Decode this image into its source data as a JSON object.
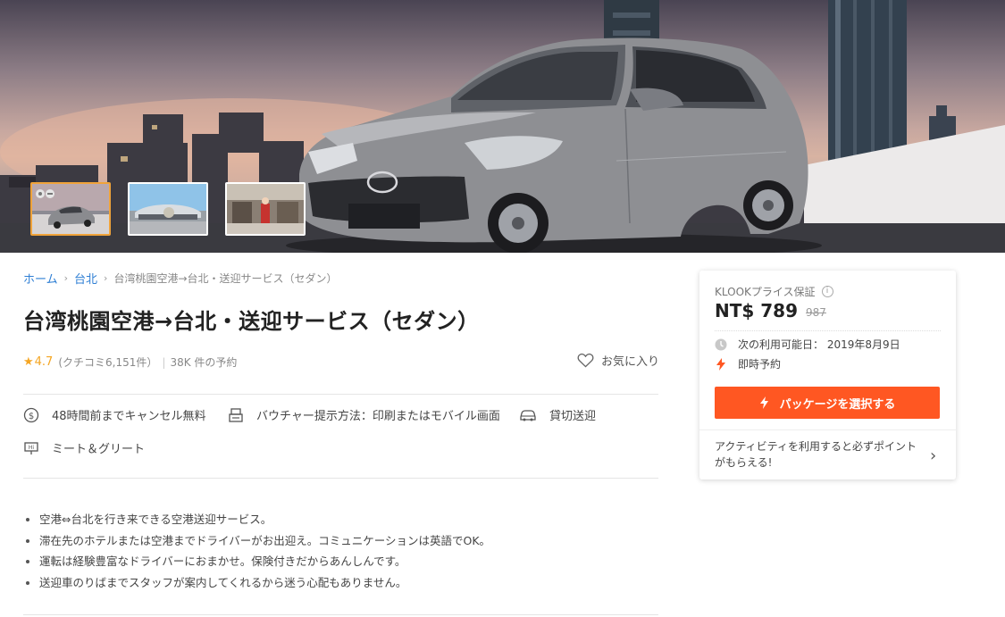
{
  "breadcrumb": {
    "home": "ホーム",
    "city": "台北",
    "current": "台湾桃園空港→台北・送迎サービス（セダン）"
  },
  "activity": {
    "title": "台湾桃園空港→台北・送迎サービス（セダン）",
    "rating_star": "★",
    "rating": "4.7",
    "reviews": "(クチコミ6,151件）",
    "divider": "|",
    "bookings": "38K 件の予約",
    "favorite_label": "お気に入り"
  },
  "features": [
    {
      "icon": "refund-icon",
      "label": "48時間前までキャンセル無料"
    },
    {
      "icon": "voucher-icon",
      "label": "バウチャー提示方法：印刷またはモバイル画面"
    },
    {
      "icon": "car-icon",
      "label": "貸切送迎"
    },
    {
      "icon": "meet-greet-icon",
      "label": "ミート＆グリート"
    }
  ],
  "highlights": [
    "空港⇔台北を行き来できる空港送迎サービス。",
    "滞在先のホテルまたは空港までドライバーがお出迎え。コミュニケーションは英語でOK。",
    "運転は経験豊富なドライバーにおまかせ。保険付きだからあんしんです。",
    "送迎車のりばまでスタッフが案内してくれるから迷う心配もありません。"
  ],
  "booking": {
    "guarantee": "KLOOKプライス保証",
    "info_glyph": "i",
    "price": "NT$ 789",
    "original_price": "987",
    "availability": "次の利用可能日： 2019年8月9日",
    "instant": "即時予約",
    "cta": "パッケージを選択する",
    "points": "アクティビティを利用すると必ずポイントがもらえる!",
    "chevron": "›"
  },
  "gallery": {
    "thumbnails": [
      "car-photo",
      "airport-photo",
      "arrival-hall-photo"
    ],
    "active_index": 0
  },
  "colors": {
    "accent": "#ff5722",
    "link": "#2f7fd4",
    "star": "#f5a623",
    "active_thumb": "#f0a33a"
  }
}
